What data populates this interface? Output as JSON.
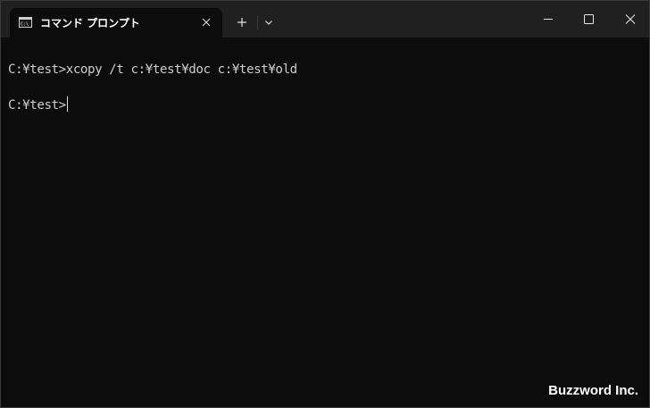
{
  "tab": {
    "title": "コマンド プロンプト",
    "icon": "command-prompt-icon",
    "close_icon": "close-icon"
  },
  "titlebar": {
    "new_tab_label": "+",
    "dropdown_icon": "chevron-down-icon",
    "minimize_icon": "minimize-icon",
    "maximize_icon": "maximize-icon",
    "close_icon": "close-icon"
  },
  "terminal": {
    "lines": [
      "C:¥test>xcopy /t c:¥test¥doc c:¥test¥old",
      "C:¥test>"
    ]
  },
  "watermark": "Buzzword Inc.",
  "colors": {
    "titlebar": "#202020",
    "terminal_bg": "#0c0c0c",
    "terminal_text": "#cccccc"
  }
}
